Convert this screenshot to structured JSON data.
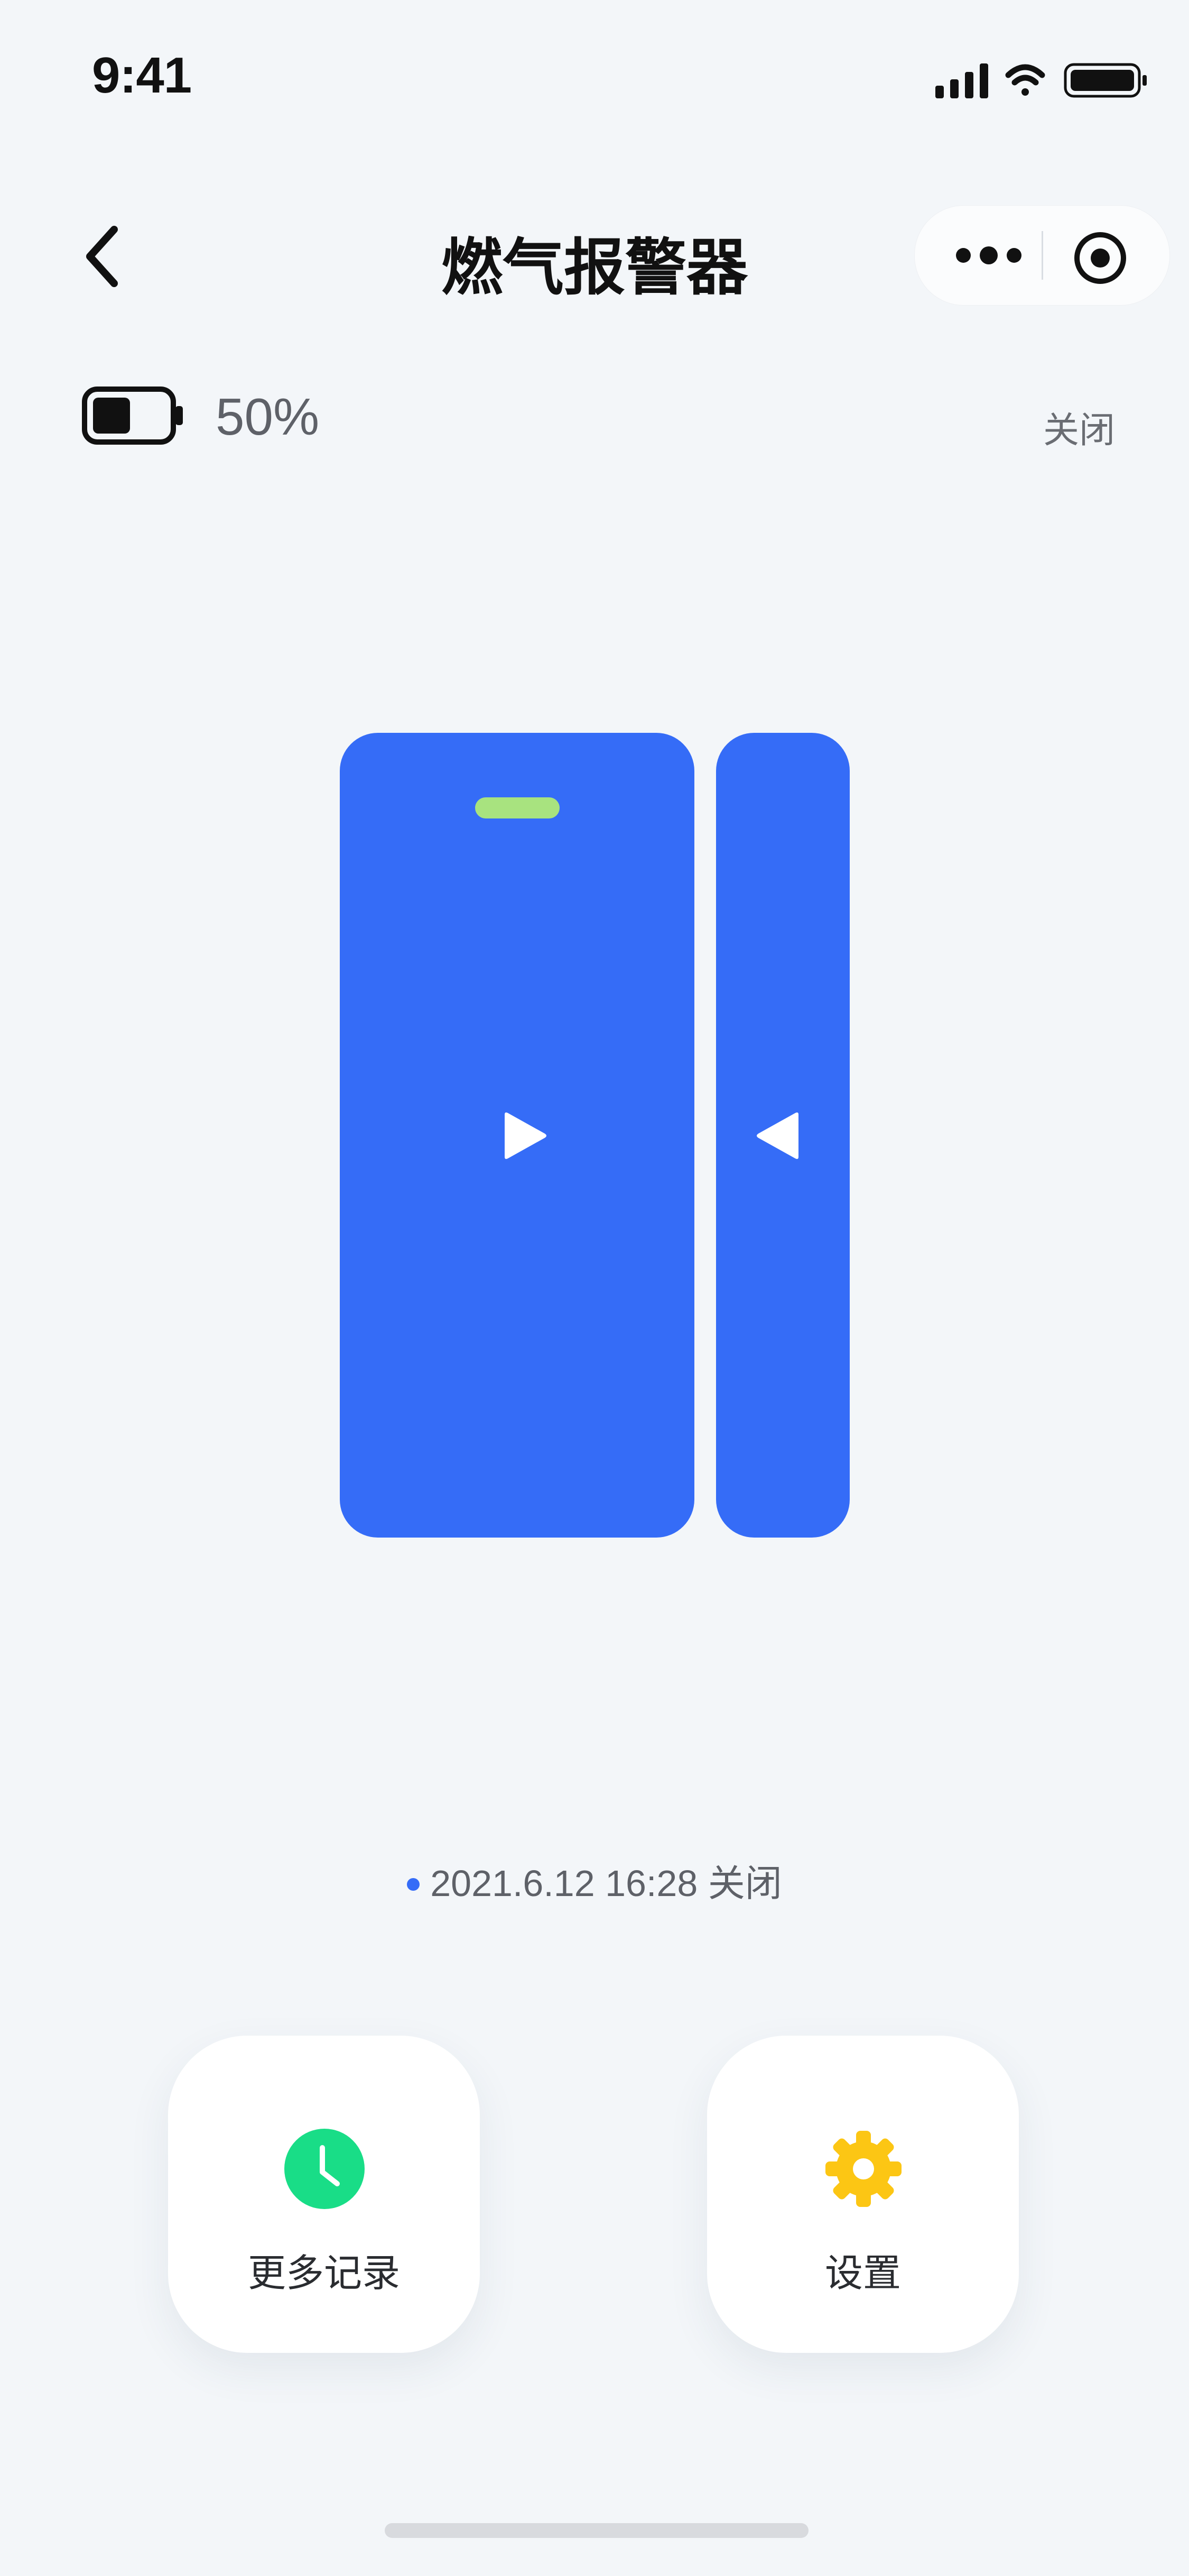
{
  "status_bar": {
    "time": "9:41",
    "icons": [
      "signal-icon",
      "wifi-icon",
      "battery-icon"
    ]
  },
  "nav": {
    "title": "燃气报警器",
    "back_icon": "chevron-left-icon",
    "capsule": {
      "more_icon": "more-dots-icon",
      "close_icon": "target-circle-icon"
    }
  },
  "device_status": {
    "battery_percent_text": "50%",
    "battery_level": 0.5,
    "state": "关闭"
  },
  "illustration": {
    "main_color": "#356cf7",
    "indicator_color": "#a8e37f"
  },
  "record": {
    "timestamp": "2021.6.12 16:28",
    "state": "关闭",
    "dot_color": "#356cf7"
  },
  "actions": [
    {
      "label": "更多记录",
      "icon": "clock-icon",
      "color": "#19dd87"
    },
    {
      "label": "设置",
      "icon": "gear-icon",
      "color": "#fcc614"
    }
  ]
}
